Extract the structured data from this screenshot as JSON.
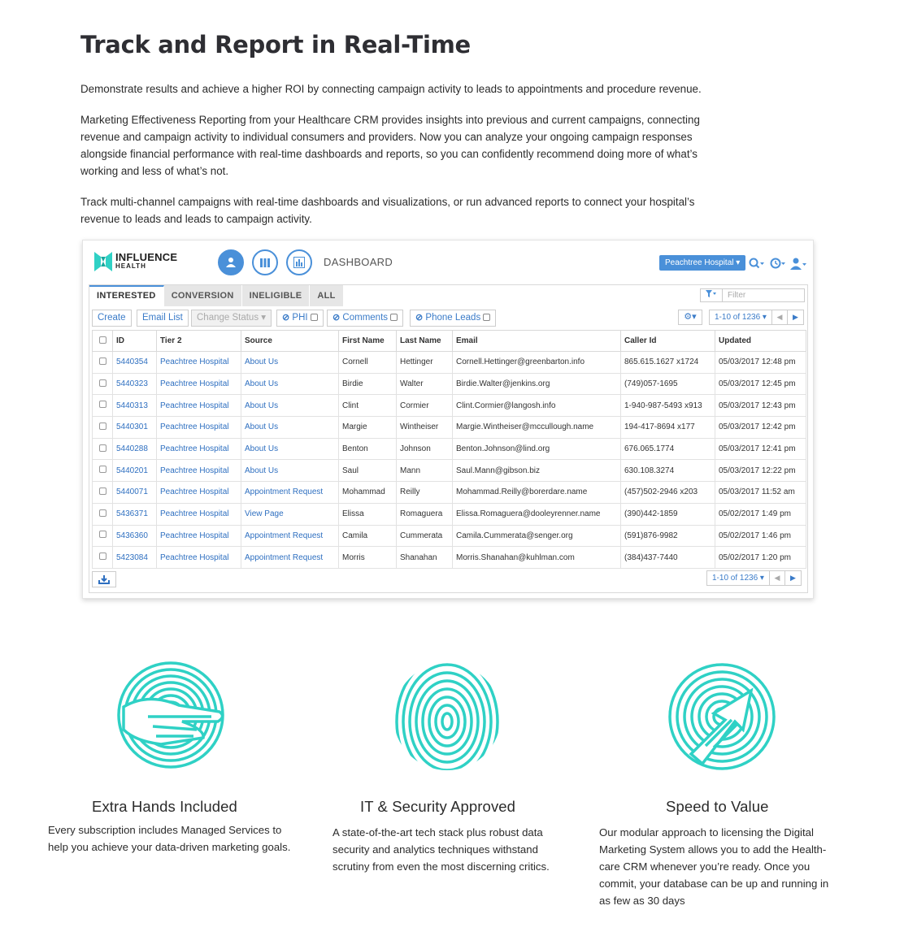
{
  "intro": {
    "title": "Track and Report in Real-Time",
    "para1": "Demonstrate results and achieve a higher ROI by connecting campaign activity to leads to appointments and procedure revenue.",
    "para2": "Marketing Effectiveness Reporting from your Healthcare CRM provides insights into previous and current campaigns, connecting revenue and campaign activity to individual consumers and providers. Now you can analyze your ongoing campaign responses alongside financial performance with real-time dashboards and reports, so you can confidently recommend doing more of what’s working and less of what’s not.",
    "para3": "Track multi-channel campaigns with real-time dashboards and visualizations, or run advanced reports to connect your hospital’s revenue to leads and leads to campaign activity."
  },
  "app": {
    "logo_line1": "INFLUENCE",
    "logo_line2": "HEALTH",
    "page_title": "DASHBOARD",
    "hospital_selector": "Peachtree Hospital ▾",
    "accent_color": "#4a90d9",
    "tabs": [
      "INTERESTED",
      "CONVERSION",
      "INELIGIBLE",
      "ALL"
    ],
    "filter_placeholder": "Filter",
    "toolbar": {
      "create": "Create",
      "email_list": "Email List",
      "change_status": "Change Status ▾",
      "phi": "PHI",
      "comments": "Comments",
      "phone_leads": "Phone Leads"
    },
    "pager_info": "1-10 of 1236 ▾",
    "columns": [
      "ID",
      "Tier 2",
      "Source",
      "First Name",
      "Last Name",
      "Email",
      "Caller Id",
      "Updated"
    ],
    "rows": [
      [
        "5440354",
        "Peachtree Hospital",
        "About Us",
        "Cornell",
        "Hettinger",
        "Cornell.Hettinger@greenbarton.info",
        "865.615.1627 x1724",
        "05/03/2017 12:48 pm"
      ],
      [
        "5440323",
        "Peachtree Hospital",
        "About Us",
        "Birdie",
        "Walter",
        "Birdie.Walter@jenkins.org",
        "(749)057-1695",
        "05/03/2017 12:45 pm"
      ],
      [
        "5440313",
        "Peachtree Hospital",
        "About Us",
        "Clint",
        "Cormier",
        "Clint.Cormier@langosh.info",
        "1-940-987-5493 x913",
        "05/03/2017 12:43 pm"
      ],
      [
        "5440301",
        "Peachtree Hospital",
        "About Us",
        "Margie",
        "Wintheiser",
        "Margie.Wintheiser@mccullough.name",
        "194-417-8694 x177",
        "05/03/2017 12:42 pm"
      ],
      [
        "5440288",
        "Peachtree Hospital",
        "About Us",
        "Benton",
        "Johnson",
        "Benton.Johnson@lind.org",
        "676.065.1774",
        "05/03/2017 12:41 pm"
      ],
      [
        "5440201",
        "Peachtree Hospital",
        "About Us",
        "Saul",
        "Mann",
        "Saul.Mann@gibson.biz",
        "630.108.3274",
        "05/03/2017 12:22 pm"
      ],
      [
        "5440071",
        "Peachtree Hospital",
        "Appointment Request",
        "Mohammad",
        "Reilly",
        "Mohammad.Reilly@borerdare.name",
        "(457)502-2946 x203",
        "05/03/2017 11:52 am"
      ],
      [
        "5436371",
        "Peachtree Hospital",
        "View Page",
        "Elissa",
        "Romaguera",
        "Elissa.Romaguera@dooleyrenner.name",
        "(390)442-1859",
        "05/02/2017 1:49 pm"
      ],
      [
        "5436360",
        "Peachtree Hospital",
        "Appointment Request",
        "Camila",
        "Cummerata",
        "Camila.Cummerata@senger.org",
        "(591)876-9982",
        "05/02/2017 1:46 pm"
      ],
      [
        "5423084",
        "Peachtree Hospital",
        "Appointment Request",
        "Morris",
        "Shanahan",
        "Morris.Shanahan@kuhlman.com",
        "(384)437-7440",
        "05/02/2017 1:20 pm"
      ]
    ]
  },
  "features": [
    {
      "icon": "hand-fingerprint-icon",
      "title": "Extra Hands Included",
      "text": "Every subscription includes Managed Services to help you achieve your data-driven marketing goals."
    },
    {
      "icon": "fingerprint-icon",
      "title": "IT & Security Approved",
      "text": "A state-of-the-art tech stack plus robust data security and analytics techniques withstand scrutiny from even the most discerning critics."
    },
    {
      "icon": "arrow-fingerprint-icon",
      "title": "Speed to Value",
      "text": "Our modular approach to licensing the Digital Marketing System allows you to add the Health-care CRM whenever you’re ready. Once you commit, your database can be up and running in as few as 30 days"
    }
  ],
  "teal_color": "#2fd1c5"
}
